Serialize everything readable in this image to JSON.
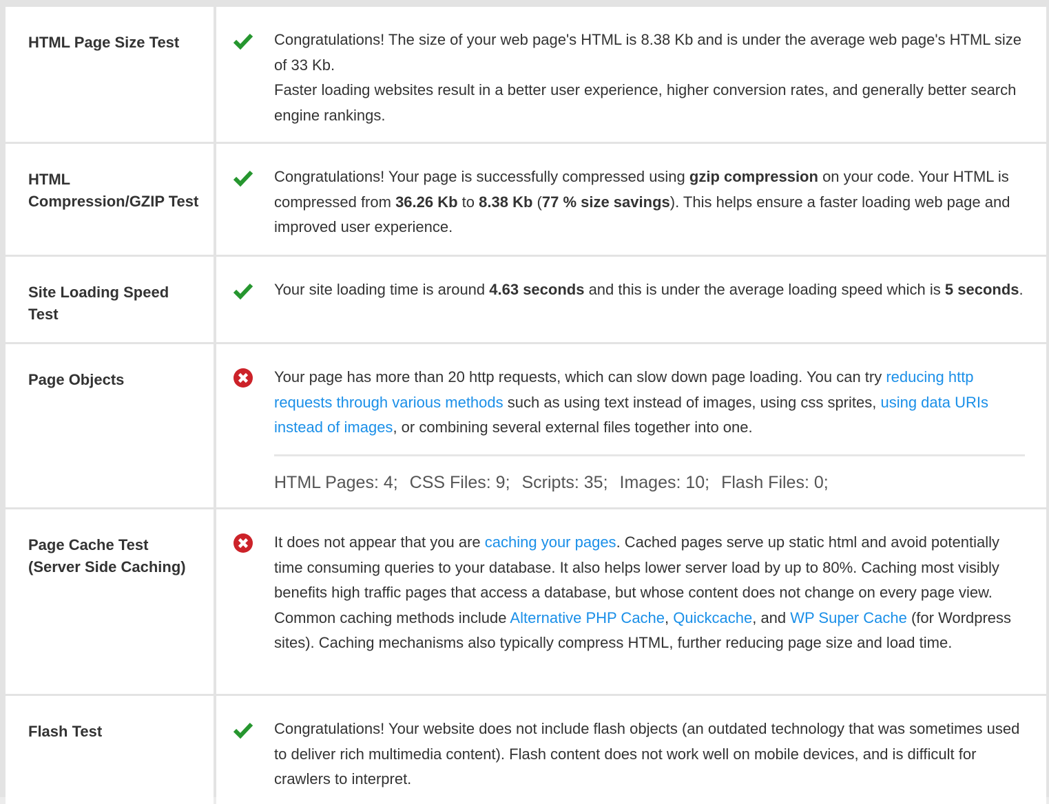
{
  "colors": {
    "pass": "#26962f",
    "fail": "#cc2229",
    "link": "#1a8fe8"
  },
  "rows": [
    {
      "label": "HTML Page Size Test",
      "status": "pass",
      "icon": "check-icon",
      "p1": "Congratulations! The size of your web page's HTML is 8.38 Kb and is under the average web page's HTML size of 33 Kb.",
      "p2": "Faster loading websites result in a better user experience, higher conversion rates, and generally better search engine rankings."
    },
    {
      "label": "HTML Compression/GZIP Test",
      "status": "pass",
      "icon": "check-icon",
      "t1": "Congratulations! Your page is successfully compressed using ",
      "b1": "gzip compression",
      "t2": " on your code. Your HTML is compressed from ",
      "b2": "36.26 Kb",
      "t3": " to ",
      "b3": "8.38 Kb",
      "t4": " (",
      "b4": "77 % size savings",
      "t5": "). This helps ensure a faster loading web page and improved user experience."
    },
    {
      "label": "Site Loading Speed Test",
      "status": "pass",
      "icon": "check-icon",
      "t1": "Your site loading time is around ",
      "b1": "4.63 seconds",
      "t2": " and this is under the average loading speed which is ",
      "b2": "5 seconds",
      "t3": "."
    },
    {
      "label": "Page Objects",
      "status": "fail",
      "icon": "error-icon",
      "t1": "Your page has more than 20 http requests, which can slow down page loading. You can try ",
      "link1": "reducing http requests through various methods",
      "t2": " such as using text instead of images, using css sprites, ",
      "link2": "using data URIs instead of images",
      "t3": ", or combining several external files together into one.",
      "stats": [
        "HTML Pages: 4;",
        "CSS Files: 9;",
        "Scripts: 35;",
        "Images: 10;",
        "Flash Files: 0;"
      ]
    },
    {
      "label": "Page Cache Test (Server Side Caching)",
      "status": "fail",
      "icon": "error-icon",
      "t1": "It does not appear that you are ",
      "link1": "caching your pages",
      "t2": ". Cached pages serve up static html and avoid potentially time consuming queries to your database. It also helps lower server load by up to 80%. Caching most visibly benefits high traffic pages that access a database, but whose content does not change on every page view. Common caching methods include ",
      "link2": "Alternative PHP Cache",
      "t3": ", ",
      "link3": "Quickcache",
      "t4": ", and ",
      "link4": "WP Super Cache",
      "t5": " (for Wordpress sites). Caching mechanisms also typically compress HTML, further reducing page size and load time."
    },
    {
      "label": "Flash Test",
      "status": "pass",
      "icon": "check-icon",
      "p1": "Congratulations! Your website does not include flash objects (an outdated technology that was sometimes used to deliver rich multimedia content). Flash content does not work well on mobile devices, and is difficult for crawlers to interpret."
    }
  ]
}
